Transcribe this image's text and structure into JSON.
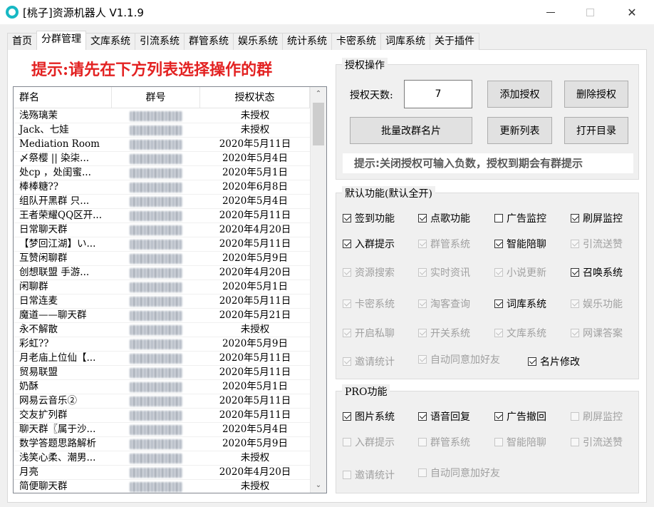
{
  "window": {
    "title": "[桃子]资源机器人 V1.1.9",
    "accent_color": "#17b8c4"
  },
  "tabs": [
    {
      "label": "首页",
      "active": false
    },
    {
      "label": "分群管理",
      "active": true
    },
    {
      "label": "文库系统",
      "active": false
    },
    {
      "label": "引流系统",
      "active": false
    },
    {
      "label": "群管系统",
      "active": false
    },
    {
      "label": "娱乐系统",
      "active": false
    },
    {
      "label": "统计系统",
      "active": false
    },
    {
      "label": "卡密系统",
      "active": false
    },
    {
      "label": "词库系统",
      "active": false
    },
    {
      "label": "关于插件",
      "active": false
    }
  ],
  "hint_left": "提示:请先在下方列表选择操作的群",
  "group_list": {
    "headers": [
      "群名",
      "群号",
      "授权状态"
    ],
    "rows": [
      {
        "name": "浅殇璃茉",
        "status": "未授权"
      },
      {
        "name": "Jack、七娃",
        "status": "未授权"
      },
      {
        "name": "Mediation Room",
        "status": "2020年5月11日"
      },
      {
        "name": "〆祭樱 || 染柒...",
        "status": "2020年5月4日"
      },
      {
        "name": "处cp  ，处闺蜜...",
        "status": "2020年5月1日"
      },
      {
        "name": "棒棒糖??",
        "status": "2020年6月8日"
      },
      {
        "name": "组队开黑群 只...",
        "status": "2020年5月4日"
      },
      {
        "name": "王者荣耀QQ区开...",
        "status": "2020年5月11日"
      },
      {
        "name": "日常聊天群",
        "status": "2020年4月20日"
      },
      {
        "name": "【梦回江湖】い...",
        "status": "2020年5月11日"
      },
      {
        "name": "互赞闲聊群",
        "status": "2020年5月9日"
      },
      {
        "name": "创想联盟 手游...",
        "status": "2020年4月20日"
      },
      {
        "name": "闲聊群",
        "status": "2020年5月1日"
      },
      {
        "name": "日常连麦",
        "status": "2020年5月11日"
      },
      {
        "name": "魔道——聊天群",
        "status": "2020年5月21日"
      },
      {
        "name": "永不解散",
        "status": "未授权"
      },
      {
        "name": "彩虹??",
        "status": "2020年5月9日"
      },
      {
        "name": "月老庙上位仙【...",
        "status": "2020年5月11日"
      },
      {
        "name": "贸易联盟",
        "status": "2020年5月11日"
      },
      {
        "name": "奶酥",
        "status": "2020年5月1日"
      },
      {
        "name": "网易云音乐②",
        "status": "2020年5月11日"
      },
      {
        "name": "交友扩列群",
        "status": "2020年5月11日"
      },
      {
        "name": "聊天群〖属于沙...",
        "status": "2020年5月4日"
      },
      {
        "name": "数学答题思路解析",
        "status": "2020年5月9日"
      },
      {
        "name": "浅笑心柔、潮男...",
        "status": "未授权"
      },
      {
        "name": "月亮",
        "status": "2020年4月20日"
      },
      {
        "name": "简便聊天群",
        "status": "未授权"
      }
    ]
  },
  "auth": {
    "title": "授权操作",
    "days_label": "授权天数:",
    "days_value": "7",
    "add_button": "添加授权",
    "delete_button": "删除授权",
    "batch_rename_button": "批量改群名片",
    "refresh_button": "更新列表",
    "open_dir_button": "打开目录",
    "hint": "提示:关闭授权可输入负数，授权到期会有群提示"
  },
  "default_features": {
    "title": "默认功能(默认全开)",
    "items": [
      {
        "label": "签到功能",
        "checked": true,
        "enabled": true
      },
      {
        "label": "点歌功能",
        "checked": true,
        "enabled": true
      },
      {
        "label": "广告监控",
        "checked": false,
        "enabled": true
      },
      {
        "label": "刷屏监控",
        "checked": true,
        "enabled": true
      },
      {
        "label": "入群提示",
        "checked": true,
        "enabled": true
      },
      {
        "label": "群管系统",
        "checked": true,
        "enabled": false
      },
      {
        "label": "智能陪聊",
        "checked": true,
        "enabled": true
      },
      {
        "label": "引流送赞",
        "checked": true,
        "enabled": false
      },
      {
        "label": "资源搜索",
        "checked": true,
        "enabled": false
      },
      {
        "label": "实时资讯",
        "checked": true,
        "enabled": false
      },
      {
        "label": "小说更新",
        "checked": true,
        "enabled": false
      },
      {
        "label": "召唤系统",
        "checked": true,
        "enabled": true
      },
      {
        "label": "卡密系统",
        "checked": true,
        "enabled": false
      },
      {
        "label": "淘客查询",
        "checked": true,
        "enabled": false
      },
      {
        "label": "词库系统",
        "checked": true,
        "enabled": true
      },
      {
        "label": "娱乐功能",
        "checked": true,
        "enabled": false
      },
      {
        "label": "开启私聊",
        "checked": true,
        "enabled": false
      },
      {
        "label": "开关系统",
        "checked": true,
        "enabled": false
      },
      {
        "label": "文库系统",
        "checked": true,
        "enabled": false
      },
      {
        "label": "网课答案",
        "checked": true,
        "enabled": false
      },
      {
        "label": "邀请统计",
        "checked": true,
        "enabled": false
      },
      {
        "label": "自动同意加好友",
        "checked": true,
        "enabled": false
      },
      {
        "label": "名片修改",
        "checked": true,
        "enabled": true
      }
    ]
  },
  "pro_features": {
    "title": "PRO功能",
    "items": [
      {
        "label": "图片系统",
        "checked": true,
        "enabled": true
      },
      {
        "label": "语音回复",
        "checked": true,
        "enabled": true
      },
      {
        "label": "广告撤回",
        "checked": true,
        "enabled": true
      },
      {
        "label": "刷屏监控",
        "checked": false,
        "enabled": false
      },
      {
        "label": "入群提示",
        "checked": false,
        "enabled": false
      },
      {
        "label": "群管系统",
        "checked": false,
        "enabled": false
      },
      {
        "label": "智能陪聊",
        "checked": false,
        "enabled": false
      },
      {
        "label": "引流送赞",
        "checked": false,
        "enabled": false
      },
      {
        "label": "邀请统计",
        "checked": false,
        "enabled": false
      },
      {
        "label": "自动同意加好友",
        "checked": false,
        "enabled": false
      }
    ]
  }
}
